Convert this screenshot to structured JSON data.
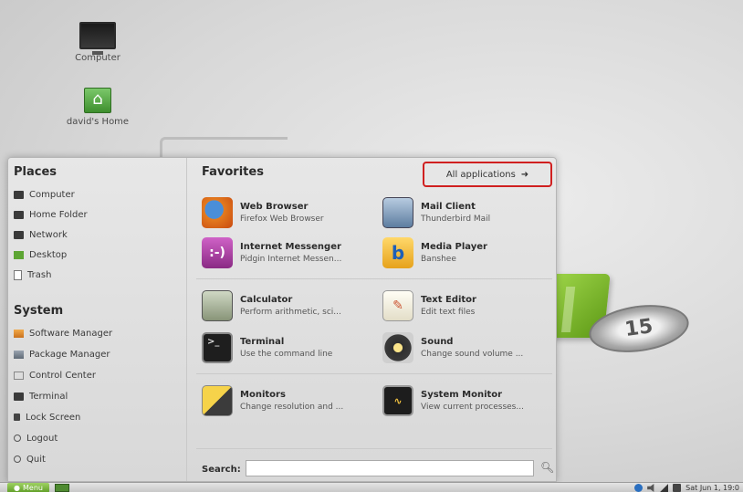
{
  "desktop": {
    "icons": [
      {
        "label": "Computer",
        "icon": "monitor-icon"
      },
      {
        "label": "david's Home",
        "icon": "home-folder-icon"
      }
    ],
    "badge_text": "15"
  },
  "menu": {
    "places": {
      "title": "Places",
      "items": [
        {
          "label": "Computer",
          "icon": "computer-icon"
        },
        {
          "label": "Home Folder",
          "icon": "home-icon"
        },
        {
          "label": "Network",
          "icon": "network-icon"
        },
        {
          "label": "Desktop",
          "icon": "desktop-icon"
        },
        {
          "label": "Trash",
          "icon": "trash-icon"
        }
      ]
    },
    "system": {
      "title": "System",
      "items": [
        {
          "label": "Software Manager",
          "icon": "software-manager-icon"
        },
        {
          "label": "Package Manager",
          "icon": "package-manager-icon"
        },
        {
          "label": "Control Center",
          "icon": "control-center-icon"
        },
        {
          "label": "Terminal",
          "icon": "terminal-icon"
        },
        {
          "label": "Lock Screen",
          "icon": "lock-icon"
        },
        {
          "label": "Logout",
          "icon": "logout-icon"
        },
        {
          "label": "Quit",
          "icon": "quit-icon"
        }
      ]
    },
    "favorites": {
      "title": "Favorites",
      "all_apps_label": "All applications",
      "apps": [
        {
          "name": "Web Browser",
          "desc": "Firefox Web Browser",
          "icon": "firefox-icon"
        },
        {
          "name": "Mail Client",
          "desc": "Thunderbird Mail",
          "icon": "mail-icon"
        },
        {
          "name": "Internet Messenger",
          "desc": "Pidgin Internet Messen...",
          "icon": "pidgin-icon",
          "glyph": ":-)"
        },
        {
          "name": "Media Player",
          "desc": "Banshee",
          "icon": "banshee-icon",
          "glyph": "b"
        },
        {
          "name": "Calculator",
          "desc": "Perform arithmetic, sci...",
          "icon": "calculator-icon"
        },
        {
          "name": "Text Editor",
          "desc": "Edit text files",
          "icon": "text-editor-icon"
        },
        {
          "name": "Terminal",
          "desc": "Use the command line",
          "icon": "terminal-icon",
          "glyph": ">_"
        },
        {
          "name": "Sound",
          "desc": "Change sound volume ...",
          "icon": "sound-icon"
        },
        {
          "name": "Monitors",
          "desc": "Change resolution and ...",
          "icon": "monitors-icon"
        },
        {
          "name": "System Monitor",
          "desc": "View current processes...",
          "icon": "system-monitor-icon"
        }
      ]
    },
    "search": {
      "label": "Search:",
      "value": ""
    }
  },
  "taskbar": {
    "menu_label": "Menu",
    "clock": "Sat Jun  1, 19:0"
  }
}
